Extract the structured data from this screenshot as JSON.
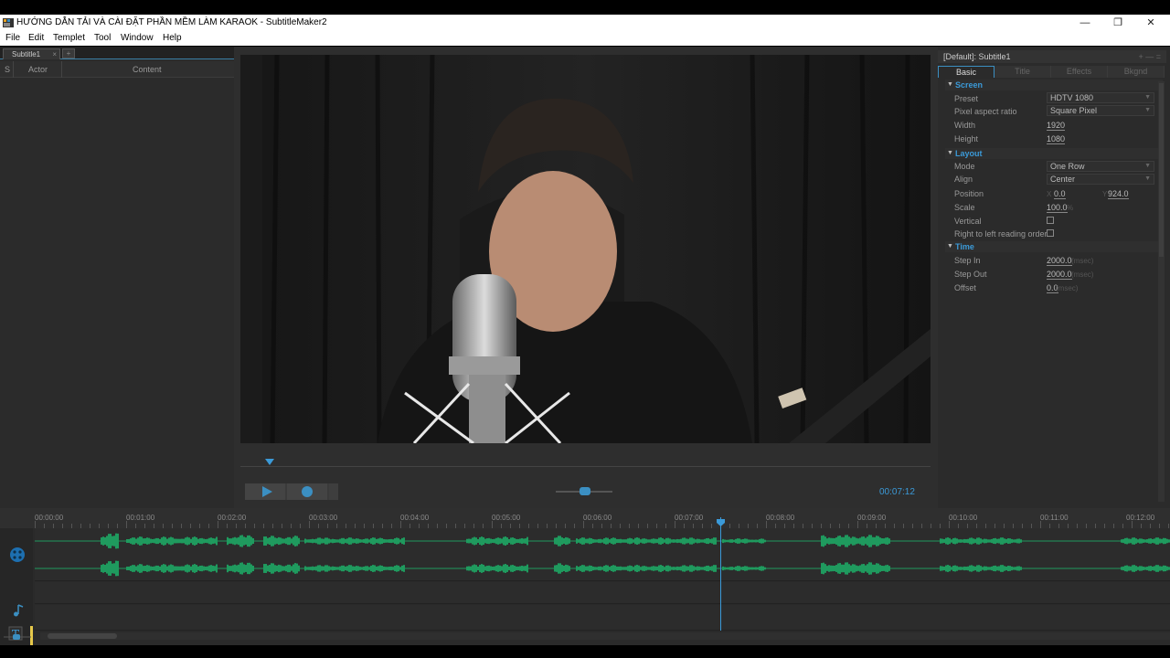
{
  "window": {
    "title": "HƯỚNG DẪN TẢI VÀ CÀI ĐẶT PHẦN MỀM LÀM KARAOK - SubtitleMaker2",
    "minimize": "—",
    "restore": "❐",
    "close": "✕"
  },
  "menu": [
    "File",
    "Edit",
    "Templet",
    "Tool",
    "Window",
    "Help"
  ],
  "subtitle_panel": {
    "tab_label": "Subtitle1",
    "tab_close": "×",
    "tab_add": "+",
    "columns": [
      "S",
      "Actor",
      "Content"
    ]
  },
  "player": {
    "timecode": "00:07:12",
    "volume_fraction": 0.52
  },
  "properties": {
    "header": "[Default]: Subtitle1",
    "header_controls": "+ — =",
    "tabs": [
      "Basic",
      "Title",
      "Effects",
      "Bkgnd"
    ],
    "active_tab": "Basic",
    "screen": {
      "title": "Screen",
      "preset_label": "Preset",
      "preset_value": "HDTV 1080",
      "par_label": "Pixel aspect ratio",
      "par_value": "Square Pixel",
      "width_label": "Width",
      "width_value": "1920",
      "height_label": "Height",
      "height_value": "1080"
    },
    "layout": {
      "title": "Layout",
      "mode_label": "Mode",
      "mode_value": "One Row",
      "align_label": "Align",
      "align_value": "Center",
      "position_label": "Position",
      "pos_x_prefix": "X",
      "pos_x": "0.0",
      "pos_y_prefix": "Y",
      "pos_y": "924.0",
      "scale_label": "Scale",
      "scale_value": "100.0",
      "scale_unit": "%",
      "vertical_label": "Vertical",
      "rtl_label": "Right to left reading order"
    },
    "time": {
      "title": "Time",
      "stepin_label": "Step In",
      "stepin_value": "2000.0",
      "stepout_label": "Step Out",
      "stepout_value": "2000.0",
      "offset_label": "Offset",
      "offset_value": "0.0",
      "unit": "(msec)"
    }
  },
  "timeline": {
    "ticks": [
      "00:00:00",
      "00:01:00",
      "00:02:00",
      "00:03:00",
      "00:04:00",
      "00:05:00",
      "00:06:00",
      "00:07:00",
      "00:08:00",
      "00:09:00",
      "00:10:00",
      "00:11:00",
      "00:12:00"
    ],
    "colors": {
      "waveform": "#1f9a5e",
      "playhead": "#3b9ad8",
      "accent": "#3b8fc2",
      "subtitle_marker": "#e6c84a"
    }
  }
}
